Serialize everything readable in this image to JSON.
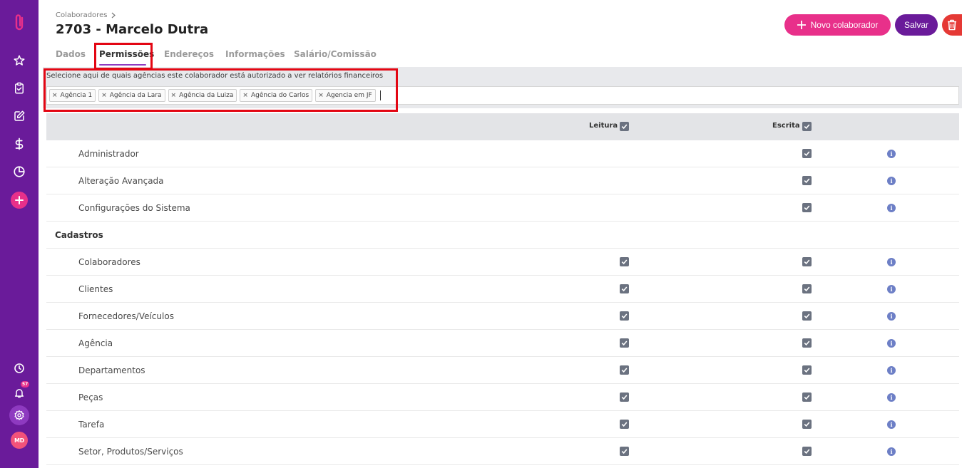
{
  "header": {
    "breadcrumb": "Colaboradores",
    "title": "2703 - Marcelo Dutra",
    "new_button": "Novo colaborador",
    "save_button": "Salvar"
  },
  "tabs": [
    {
      "label": "Dados"
    },
    {
      "label": "Permissões",
      "active": true
    },
    {
      "label": "Endereços"
    },
    {
      "label": "Informações"
    },
    {
      "label": "Salário/Comissão"
    }
  ],
  "agencies": {
    "label": "Selecione aqui de quais agências este colaborador está autorizado a ver relatórios financeiros",
    "tags": [
      "Agência 1",
      "Agência da Lara",
      "Agência da Luiza",
      "Agência do Carlos",
      "Agencia em JF"
    ]
  },
  "table": {
    "col_read": "Leitura",
    "col_write": "Escrita",
    "header_read_checked": true,
    "header_write_checked": true,
    "rows": [
      {
        "label": "Administrador",
        "read": false,
        "write": true
      },
      {
        "label": "Alteração Avançada",
        "read": false,
        "write": true
      },
      {
        "label": "Configurações do Sistema",
        "read": false,
        "write": true
      },
      {
        "section": "Cadastros"
      },
      {
        "label": "Colaboradores",
        "read": true,
        "write": true
      },
      {
        "label": "Clientes",
        "read": true,
        "write": true
      },
      {
        "label": "Fornecedores/Veículos",
        "read": true,
        "write": true
      },
      {
        "label": "Agência",
        "read": true,
        "write": true
      },
      {
        "label": "Departamentos",
        "read": true,
        "write": true
      },
      {
        "label": "Peças",
        "read": true,
        "write": true
      },
      {
        "label": "Tarefa",
        "read": true,
        "write": true
      },
      {
        "label": "Setor, Produtos/Serviços",
        "read": true,
        "write": true
      }
    ]
  },
  "sidebar": {
    "notification_count": "57",
    "avatar_initials": "MD",
    "icons": [
      "paperclip-logo-icon",
      "star-icon",
      "clipboard-icon",
      "edit-icon",
      "dollar-icon",
      "pie-chart-icon",
      "plus-icon",
      "clock-icon",
      "bell-icon",
      "gear-icon"
    ]
  },
  "colors": {
    "sidebar": "#6a1b9a",
    "accent_pink": "#e8308a",
    "accent_purple": "#6a1b9a",
    "danger": "#e53935",
    "highlight": "#e30613",
    "checkbox": "#6b7280",
    "info": "#6d7fc6"
  }
}
